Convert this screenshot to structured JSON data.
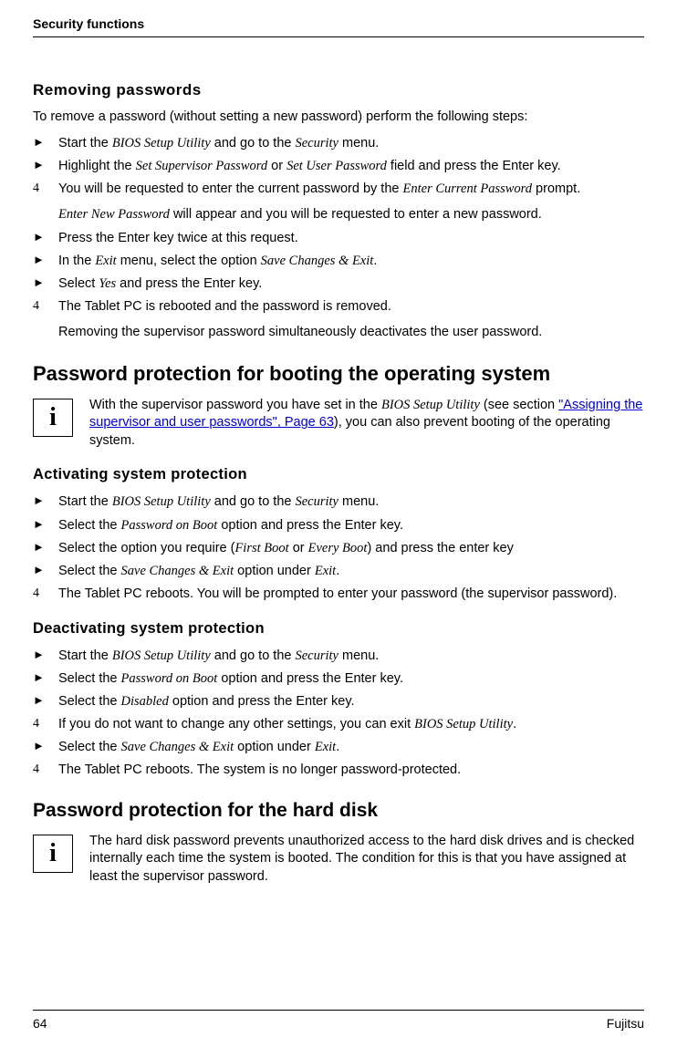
{
  "header": "Security functions",
  "removing": {
    "title": "Removing passwords",
    "intro": "To remove a password (without setting a new password) perform the following steps:",
    "step1": "Start the <em class='term'>BIOS Setup Utility</em> and go to the <em class='term'>Security</em> menu.",
    "step2": "Highlight the <em class='term'>Set Supervisor Password</em> or <em class='term'>Set User Password</em> field and press the Enter key.",
    "step3": "You will be requested to enter the current password by the <em class='term'>Enter Current Password</em> prompt.",
    "step3b": "<em class='term'>Enter New Password</em> will appear and you will be requested to enter a new password.",
    "step4": "Press the Enter key twice at this request.",
    "step5": "In the <em class='term'>Exit</em> menu, select the option <em class='term'>Save Changes & Exit</em>.",
    "step6": "Select <em class='term'>Yes</em> and press the Enter key.",
    "step7": "The Tablet PC is rebooted and the password is removed.",
    "step7b": "Removing the supervisor password simultaneously deactivates the user password."
  },
  "booting": {
    "title": "Password protection for booting the operating system",
    "info": "With the supervisor password you have set in the <em class='term'>BIOS Setup Utility</em> (see section <span class='link'>\"Assigning the supervisor and user passwords\", Page 63</span>), you can also prevent booting of the operating system."
  },
  "activating": {
    "title": "Activating system protection",
    "step1": "Start the <em class='term'>BIOS Setup Utility</em> and go to the <em class='term'>Security</em> menu.",
    "step2": "Select the <em class='term'>Password on Boot</em> option and press the Enter key.",
    "step3": "Select the option you require (<em class='term'>First Boot</em> or <em class='term'>Every Boot</em>) and press the enter key",
    "step4": "Select the <em class='term'>Save Changes & Exit</em> option under <em class='term'>Exit</em>.",
    "step5": "The Tablet PC reboots. You will be prompted to enter your password (the supervisor password)."
  },
  "deactivating": {
    "title": "Deactivating system protection",
    "step1": "Start the <em class='term'>BIOS Setup Utility</em> and go to the <em class='term'>Security</em> menu.",
    "step2": "Select the <em class='term'>Password on Boot</em> option and press the Enter key.",
    "step3": "Select the <em class='term'>Disabled</em> option and press the Enter key.",
    "step4": "If you do not want to change any other settings, you can exit <em class='term'>BIOS Setup Utility</em>.",
    "step5": "Select the <em class='term'>Save Changes & Exit</em> option under <em class='term'>Exit</em>.",
    "step6": "The Tablet PC reboots. The system is no longer password-protected."
  },
  "harddisk": {
    "title": "Password protection for the hard disk",
    "info": "The hard disk password prevents unauthorized access to the hard disk drives and is checked internally each time the system is booted. The condition for this is that you have assigned at least the supervisor password."
  },
  "footer": {
    "page": "64",
    "brand": "Fujitsu"
  },
  "info_i": "i"
}
